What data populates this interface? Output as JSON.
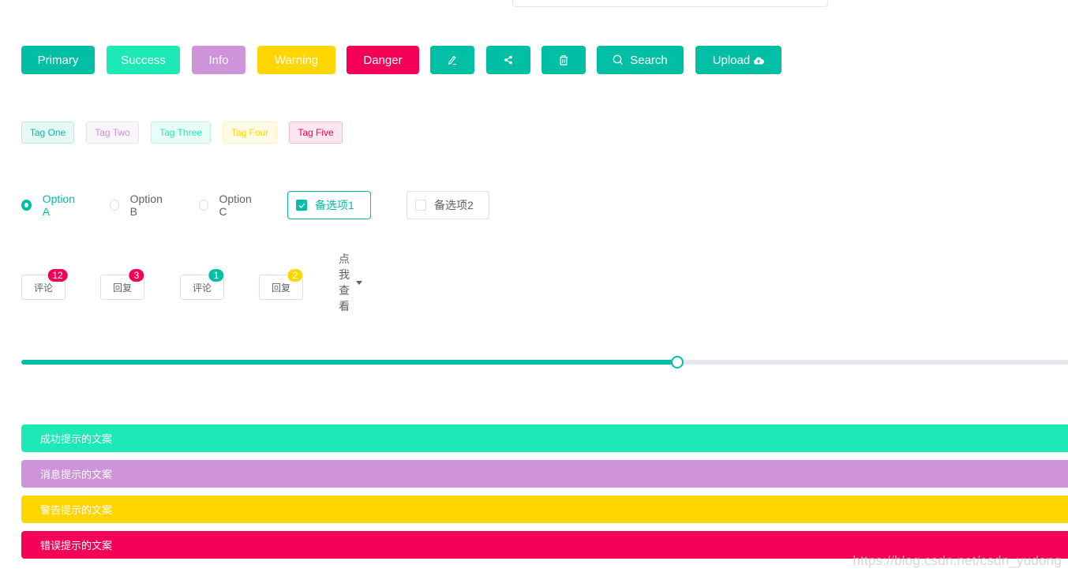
{
  "colors": {
    "primary": "#00bfa5",
    "success": "#1de9b6",
    "info": "#ce93d8",
    "warning": "#ffd600",
    "danger": "#f50057",
    "border": "#dcdfe6",
    "text": "#606266"
  },
  "top_input": {
    "value": "",
    "placeholder": ""
  },
  "buttons": [
    {
      "label": "Primary",
      "type": "primary",
      "color": "#00bfa5"
    },
    {
      "label": "Success",
      "type": "success",
      "color": "#1de9b6"
    },
    {
      "label": "Info",
      "type": "info",
      "color": "#ce93d8"
    },
    {
      "label": "Warning",
      "type": "warning",
      "color": "#ffd600"
    },
    {
      "label": "Danger",
      "type": "danger",
      "color": "#f50057"
    },
    {
      "label": "",
      "icon": "edit-icon",
      "color": "#00bfa5"
    },
    {
      "label": "",
      "icon": "share-icon",
      "color": "#00bfa5"
    },
    {
      "label": "",
      "icon": "delete-icon",
      "color": "#00bfa5"
    },
    {
      "label": "Search",
      "icon": "search-icon",
      "color": "#00bfa5"
    },
    {
      "label": "Upload",
      "icon": "upload-cloud-icon",
      "color": "#00bfa5"
    }
  ],
  "tags": [
    {
      "label": "Tag One",
      "color": "#00bfa5",
      "bg": "#e6f9f6",
      "border": "#b3ece4"
    },
    {
      "label": "Tag Two",
      "color": "#ce93d8",
      "bg": "#faf4fb",
      "border": "#f0dff3"
    },
    {
      "label": "Tag Three",
      "color": "#1de9b6",
      "bg": "#e8fdf8",
      "border": "#bbf8e9"
    },
    {
      "label": "Tag Four",
      "color": "#ffd600",
      "bg": "#fffbe6",
      "border": "#fff3b3"
    },
    {
      "label": "Tag Five",
      "color": "#f50057",
      "bg": "#fee6ee",
      "border": "#fcb3cd"
    }
  ],
  "radios": {
    "selected": "Option A",
    "options": [
      "Option A",
      "Option B",
      "Option C"
    ]
  },
  "checkboxes": [
    {
      "label": "备选项1",
      "checked": true
    },
    {
      "label": "备选项2",
      "checked": false
    }
  ],
  "badges": [
    {
      "label": "评论",
      "count": "12",
      "color": "#f50057"
    },
    {
      "label": "回复",
      "count": "3",
      "color": "#f50057"
    },
    {
      "label": "评论",
      "count": "1",
      "color": "#00bfa5"
    },
    {
      "label": "回复",
      "count": "2",
      "color": "#ffd600"
    }
  ],
  "dropdown": {
    "label": "点我查看",
    "icon": "caret-down-icon"
  },
  "slider": {
    "value": 62,
    "min": 0,
    "max": 100
  },
  "alerts": [
    {
      "type": "success",
      "text": "成功提示的文案",
      "color": "#1de9b6"
    },
    {
      "type": "info",
      "text": "消息提示的文案",
      "color": "#ce93d8"
    },
    {
      "type": "warning",
      "text": "警告提示的文案",
      "color": "#ffd600"
    },
    {
      "type": "error",
      "text": "错误提示的文案",
      "color": "#f50057"
    }
  ],
  "watermark": "https://blog.csdn.net/csdn_yudong"
}
